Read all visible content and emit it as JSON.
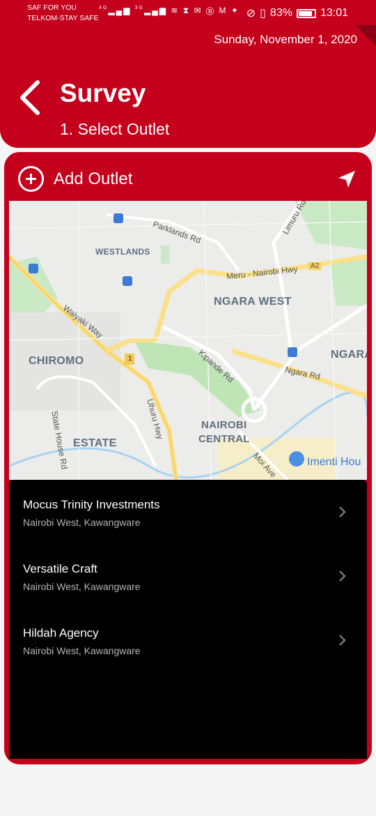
{
  "status_bar": {
    "carrier_1": "SAF FOR YOU",
    "carrier_2": "TELKOM-STAY SAFE",
    "network_1": "4G",
    "network_2": "3G",
    "battery_percent": "83%",
    "time": "13:01"
  },
  "header": {
    "date": "Sunday, November 1, 2020",
    "title": "Survey",
    "subtitle": "1. Select Outlet"
  },
  "card": {
    "add_outlet_label": "Add Outlet"
  },
  "map": {
    "areas": [
      "WESTLANDS",
      "NGARA WEST",
      "CHIROMO",
      "NGARA",
      "ESTATE",
      "NAIROBI",
      "CENTRAL"
    ],
    "roads": [
      "Parklands Rd",
      "Limuru Rd",
      "Meru - Nairobi Hwy",
      "A2",
      "Waiyaki Way",
      "Kipande Rd",
      "Ngara Rd",
      "Uhuru Hwy",
      "State House Rd",
      "Moi Ave"
    ],
    "route_badge": "1",
    "poi": "Imenti Hou"
  },
  "outlets": [
    {
      "name": "Mocus Trinity Investments",
      "location": "Nairobi West, Kawangware"
    },
    {
      "name": "Versatile Craft",
      "location": "Nairobi West, Kawangware"
    },
    {
      "name": "Hildah Agency",
      "location": "Nairobi West, Kawangware"
    }
  ]
}
